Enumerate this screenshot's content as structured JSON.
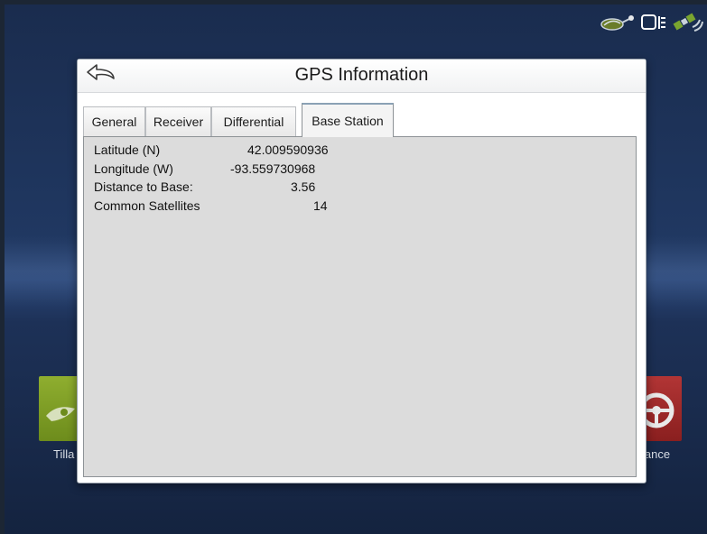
{
  "dialog": {
    "title": "GPS Information"
  },
  "tabs": [
    {
      "label": "General",
      "active": false
    },
    {
      "label": "Receiver",
      "active": false
    },
    {
      "label": "Differential",
      "active": false
    },
    {
      "label": "Base Station",
      "active": true
    }
  ],
  "base_station": {
    "rows": [
      {
        "label": "Latitude (N)",
        "value": "42.009590936"
      },
      {
        "label": "Longitude (W)",
        "value": "-93.559730968"
      },
      {
        "label": "Distance to Base:",
        "value": "3.56"
      },
      {
        "label": "Common Satellites",
        "value": "14"
      }
    ]
  },
  "home_screen": {
    "tile_left_caption": "Tilla",
    "tile_right_caption": "lance",
    "tile_left_color": "#7d9b24",
    "tile_right_color": "#a12b2b"
  },
  "status_icons": [
    "implement-icon",
    "display-icon",
    "gps-satellite-icon"
  ],
  "colors": {
    "screen_background": "#1f355d",
    "dialog_background": "#ffffff",
    "panel_background": "#dcdcdc"
  }
}
